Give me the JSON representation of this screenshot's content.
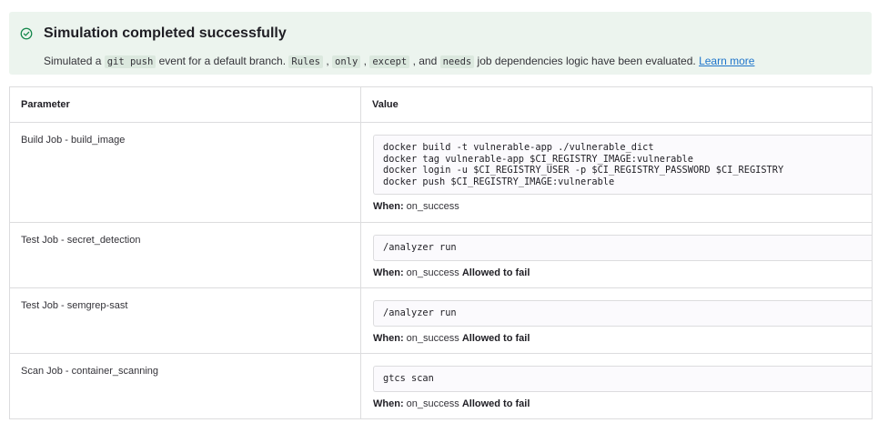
{
  "alert": {
    "title": "Simulation completed successfully",
    "text_1": "Simulated a ",
    "code_1": "git push",
    "text_2": " event for a default branch. ",
    "code_2": "Rules",
    "text_3": " , ",
    "code_3": "only",
    "text_4": " , ",
    "code_4": "except",
    "text_5": " , and ",
    "code_5": "needs",
    "text_6": " job dependencies logic have been evaluated. ",
    "learn_more": "Learn more",
    "icon": "check-circle-icon",
    "accent": "#108548"
  },
  "table": {
    "headers": {
      "parameter": "Parameter",
      "value": "Value"
    },
    "when_label": "When:",
    "rows": [
      {
        "parameter": "Build Job - build_image",
        "script": "docker build -t vulnerable-app ./vulnerable_dict\ndocker tag vulnerable-app $CI_REGISTRY_IMAGE:vulnerable\ndocker login -u $CI_REGISTRY_USER -p $CI_REGISTRY_PASSWORD $CI_REGISTRY\ndocker push $CI_REGISTRY_IMAGE:vulnerable",
        "when": "on_success",
        "allow_failure": ""
      },
      {
        "parameter": "Test Job - secret_detection",
        "script": "/analyzer run",
        "when": "on_success",
        "allow_failure": "Allowed to fail"
      },
      {
        "parameter": "Test Job - semgrep-sast",
        "script": "/analyzer run",
        "when": "on_success",
        "allow_failure": "Allowed to fail"
      },
      {
        "parameter": "Scan Job - container_scanning",
        "script": "gtcs scan",
        "when": "on_success",
        "allow_failure": "Allowed to fail"
      }
    ]
  }
}
